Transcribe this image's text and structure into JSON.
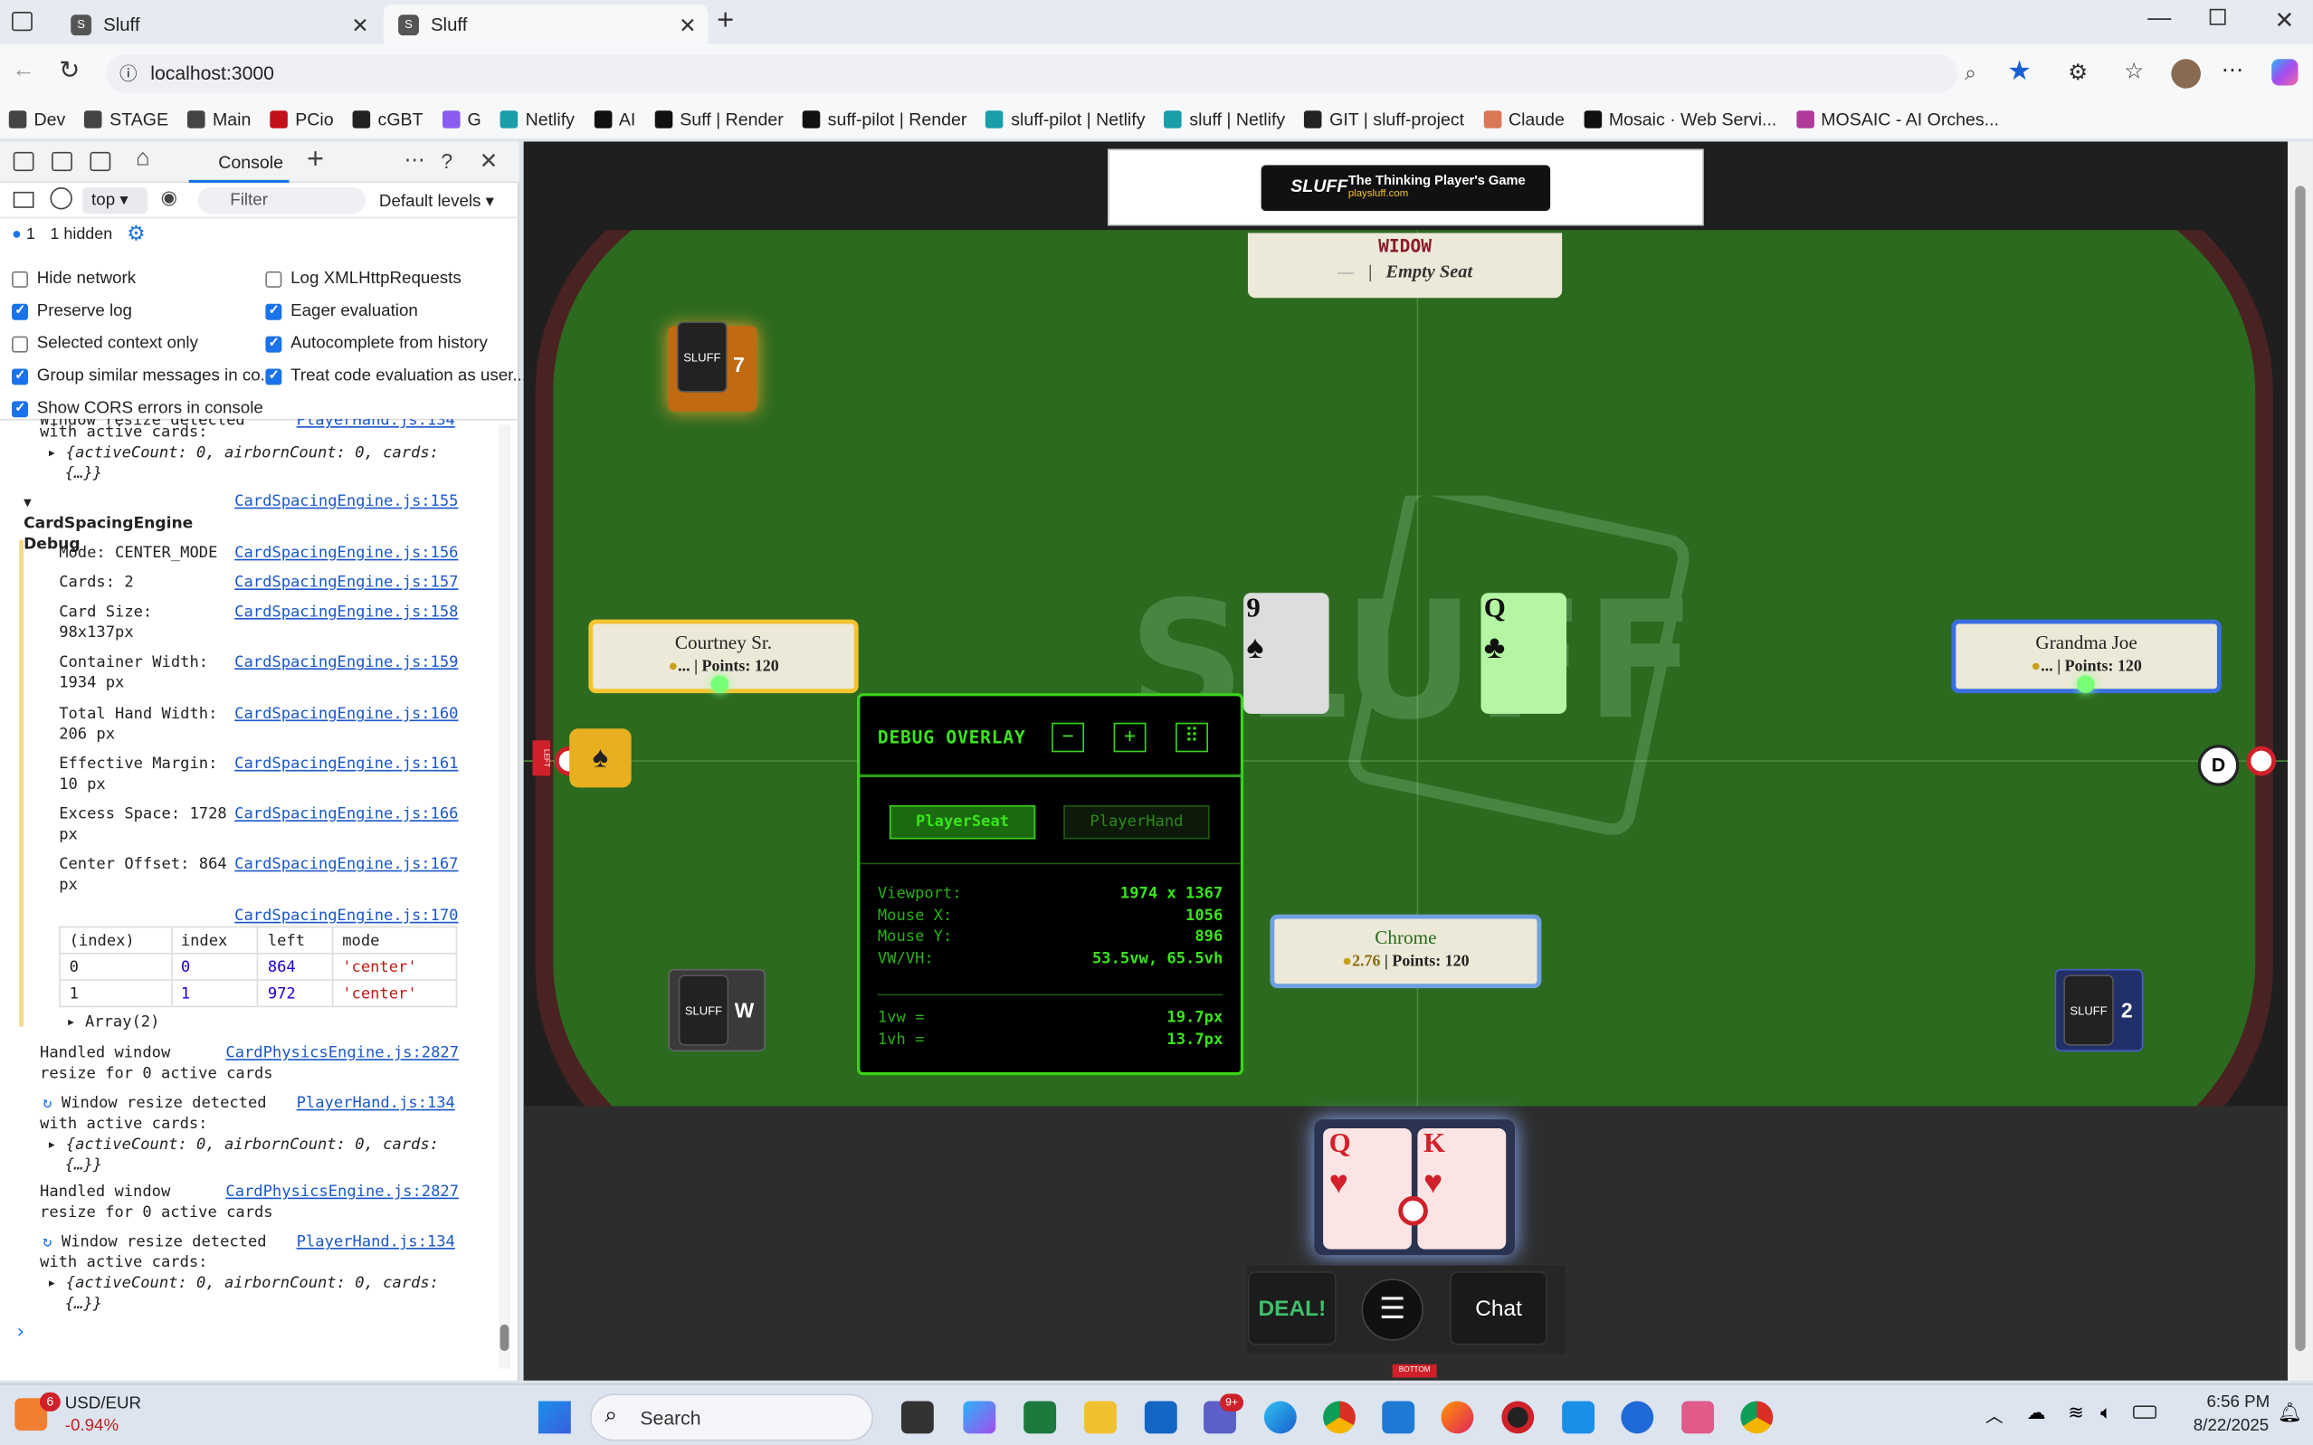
{
  "browser": {
    "tabs": [
      {
        "title": "Sluff"
      },
      {
        "title": "Sluff"
      }
    ],
    "url": "localhost:3000",
    "bookmarks": [
      "Dev",
      "STAGE",
      "Main",
      "PCio",
      "cGBT",
      "G",
      "Netlify",
      "AI",
      "Suff | Render",
      "suff-pilot | Render",
      "sluff-pilot | Netlify",
      "sluff | Netlify",
      "GIT | sluff-project",
      "Claude",
      "Mosaic · Web Servi...",
      "MOSAIC - AI Orches..."
    ]
  },
  "devtools": {
    "tab": "Console",
    "context": "top",
    "filter_placeholder": "Filter",
    "levels": "Default levels",
    "badge_count": "1",
    "hidden": "1 hidden",
    "options_left": [
      "Hide network",
      "Preserve log",
      "Selected context only",
      "Group similar messages in co...",
      "Show CORS errors in console"
    ],
    "options_right": [
      "Log XMLHttpRequests",
      "Eager evaluation",
      "Autocomplete from history",
      "Treat code evaluation as user..."
    ],
    "log": {
      "l0": "Window resize detected",
      "l0b": "with active cards:",
      "obj": "{activeCount: 0, airbornCount: 0, cards:",
      "obj2": "{…}}",
      "group": "CardSpacingEngine Debug",
      "group_src": "CardSpacingEngine.js:155",
      "entries": [
        {
          "t": "Mode: CENTER_MODE",
          "s": "CardSpacingEngine.js:156"
        },
        {
          "t": "Cards: 2",
          "s": "CardSpacingEngine.js:157"
        },
        {
          "t": "Card Size:",
          "t2": "98x137px",
          "s": "CardSpacingEngine.js:158"
        },
        {
          "t": "Container Width:",
          "t2": "1934 px",
          "s": "CardSpacingEngine.js:159"
        },
        {
          "t": "Total Hand Width:",
          "t2": "206 px",
          "s": "CardSpacingEngine.js:160"
        },
        {
          "t": "Effective Margin:",
          "t2": "10 px",
          "s": "CardSpacingEngine.js:161"
        },
        {
          "t": "Excess Space: 1728",
          "t2": "px",
          "s": "CardSpacingEngine.js:166"
        },
        {
          "t": "Center Offset: 864",
          "t2": "px",
          "s": "CardSpacingEngine.js:167"
        }
      ],
      "table_src": "CardSpacingEngine.js:170",
      "table_head": [
        "(index)",
        "index",
        "left",
        "mode"
      ],
      "table_rows": [
        [
          "0",
          "0",
          "864",
          "'center'"
        ],
        [
          "1",
          "1",
          "972",
          "'center'"
        ]
      ],
      "array": "Array(2)",
      "h1": "Handled window",
      "h2": "resize for 0 active cards",
      "hsrc": "CardPhysicsEngine.js:2827",
      "w1": "Window resize detected",
      "w2": "with active cards:",
      "wsrc": "PlayerHand.js:134"
    }
  },
  "game": {
    "banner_logo": "SLUFF",
    "banner_title": "The Thinking Player's Game",
    "banner_url": "playsluff.com",
    "widow_label": "WIDOW",
    "widow_dash": "—",
    "widow_seat": "Empty Seat",
    "left_player": {
      "name": "Courtney Sr.",
      "coins": "...",
      "points": "Points: 120"
    },
    "right_player": {
      "name": "Grandma Joe",
      "coins": "...",
      "points": "Points: 120"
    },
    "me": {
      "name": "Chrome",
      "coins": "2.76",
      "points": "Points: 120"
    },
    "deck_count_top": "7",
    "deck_w": "W",
    "deck_count_right": "2",
    "trick_cards": [
      {
        "rank": "9",
        "suit": "♠"
      },
      {
        "rank": "Q",
        "suit": "♣"
      }
    ],
    "hand": [
      {
        "rank": "Q",
        "suit": "♥"
      },
      {
        "rank": "K",
        "suit": "♥"
      }
    ],
    "dealer_badge": "D",
    "left_tag": "LEFT",
    "bottom_tag": "BOTTOM",
    "debug": {
      "title": "DEBUG OVERLAY",
      "minus": "−",
      "plus": "+",
      "grip": "⠿",
      "tab1": "PlayerSeat",
      "tab2": "PlayerHand",
      "rows": [
        [
          "Viewport:",
          "1974 x 1367"
        ],
        [
          "Mouse X:",
          "1056"
        ],
        [
          "Mouse Y:",
          "896"
        ],
        [
          "VW/VH:",
          "53.5vw, 65.5vh"
        ]
      ],
      "rows2": [
        [
          "1vw =",
          "19.7px"
        ],
        [
          "1vh =",
          "13.7px"
        ]
      ]
    },
    "deal": "DEAL!",
    "chat": "Chat"
  },
  "taskbar": {
    "currency": "USD/EUR",
    "change": "-0.94%",
    "weather_badge": "6",
    "search": "Search",
    "time": "6:56 PM",
    "date": "8/22/2025",
    "teams_badge": "9+"
  },
  "colors": {
    "felt": "#2a6a1f",
    "debug_green": "#39e61a",
    "rail": "#4a1f1f"
  }
}
